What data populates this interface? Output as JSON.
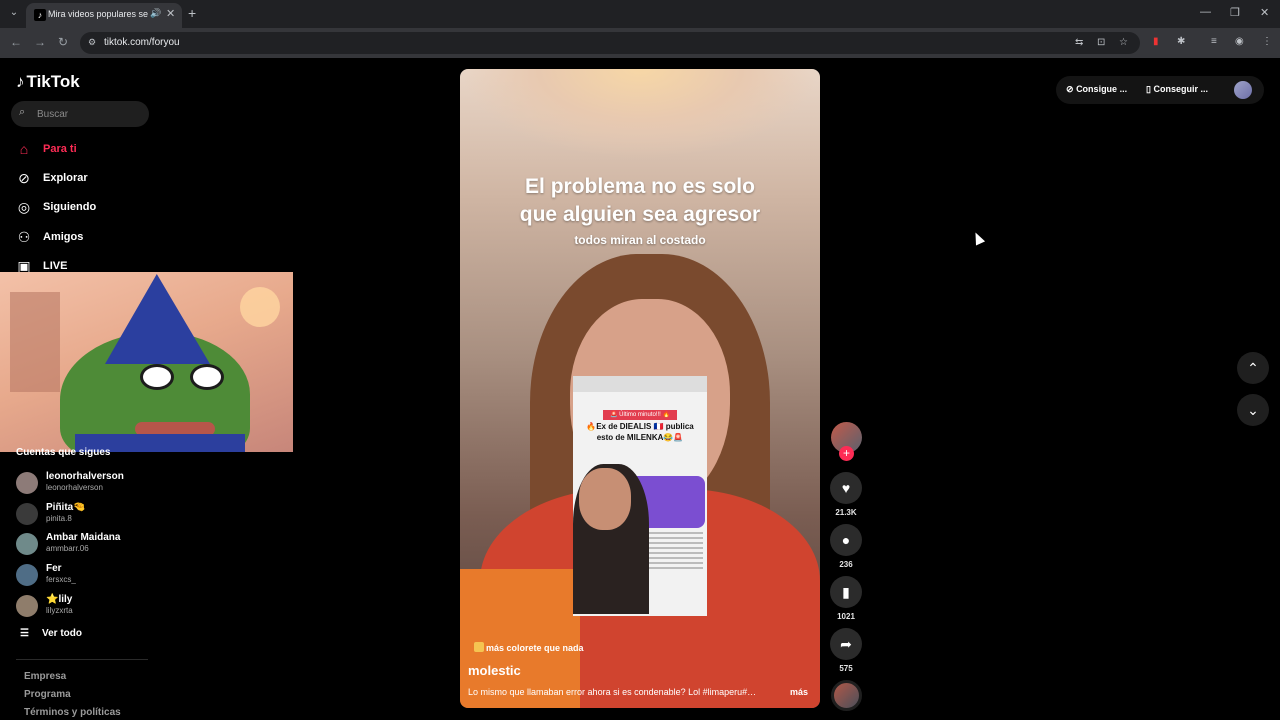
{
  "browser": {
    "tab_title": "Mira videos populares seleccionados para ti",
    "url": "tiktok.com/foryou"
  },
  "sidebar": {
    "logo": "TikTok",
    "search_placeholder": "Buscar",
    "nav": [
      {
        "label": "Para ti",
        "icon": "home-icon",
        "active": true
      },
      {
        "label": "Explorar",
        "icon": "compass-icon"
      },
      {
        "label": "Siguiendo",
        "icon": "following-icon"
      },
      {
        "label": "Amigos",
        "icon": "friends-icon"
      },
      {
        "label": "LIVE",
        "icon": "live-icon"
      }
    ],
    "following_title": "Cuentas que sigues",
    "accounts": [
      {
        "name": "leonorhalverson",
        "username": "leonorhalverson"
      },
      {
        "name": "Piñita🤏",
        "username": "pinita.8"
      },
      {
        "name": "Ambar Maidana",
        "username": "ammbarr.06"
      },
      {
        "name": "Fer",
        "username": "fersxcs_"
      },
      {
        "name": "⭐lily",
        "username": "lilyzxrta"
      }
    ],
    "see_all": "Ver todo",
    "footer": [
      "Empresa",
      "Programa",
      "Términos y políticas"
    ]
  },
  "video": {
    "headline_1": "El problema no es solo",
    "headline_2": "que alguien sea agresor",
    "subline": "todos miran al costado",
    "inset_tag": "🚨 Último minuto!!! 🔥",
    "inset_title": "🔥Ex de DIEALIS 🇫🇷 publica esto de MILENKA😂🚨",
    "audio": "más colorete que nada",
    "author": "molestic",
    "caption": "Lo mismo que llamaban error ahora si es condenable? Lol  #limaperu#…",
    "more": "más"
  },
  "actions": {
    "likes": "21.3K",
    "comments": "236",
    "saves": "1021",
    "shares": "575"
  },
  "topbar": {
    "btn1": "Consigue ...",
    "btn2": "Conseguir ..."
  },
  "colors": {
    "accent": "#fe2c55",
    "background": "#000000"
  }
}
